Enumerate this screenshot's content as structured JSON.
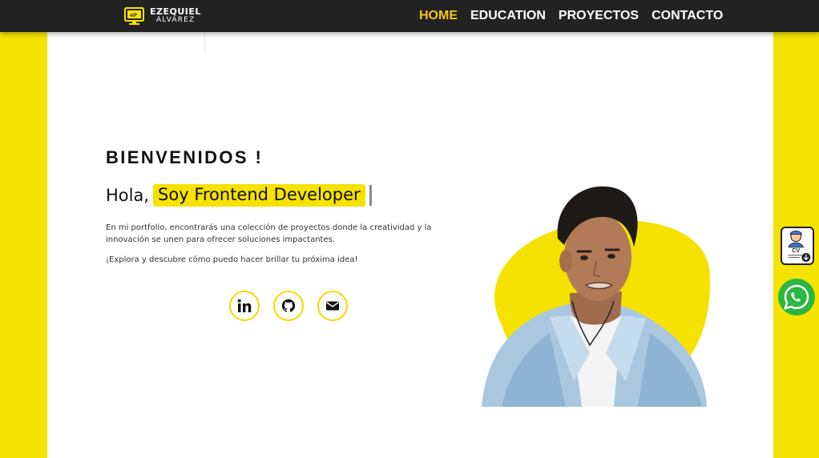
{
  "brand": {
    "line1": "EZEQUIEL",
    "line2": "ALVAREZ"
  },
  "nav": [
    {
      "label": "HOME",
      "active": true
    },
    {
      "label": "EDUCATION",
      "active": false
    },
    {
      "label": "PROYECTOS",
      "active": false
    },
    {
      "label": "CONTACTO",
      "active": false
    }
  ],
  "hero": {
    "welcome": "BIENVENIDOS !",
    "greeting": "Hola,",
    "role": "Soy Frontend Developer",
    "description": "En mi portfolio, encontrarás una colección de proyectos donde la creatividad y la innovación se unen para ofrecer soluciones impactantes.",
    "cta": "¡Explora y descubre cómo puedo hacer brillar tu próxima idea!"
  },
  "social": [
    "linkedin-icon",
    "github-icon",
    "email-icon"
  ],
  "side": {
    "cv_label": "CV"
  },
  "colors": {
    "accent": "#f5e200",
    "nav_bg": "#222222",
    "active_link": "#f5c518"
  }
}
